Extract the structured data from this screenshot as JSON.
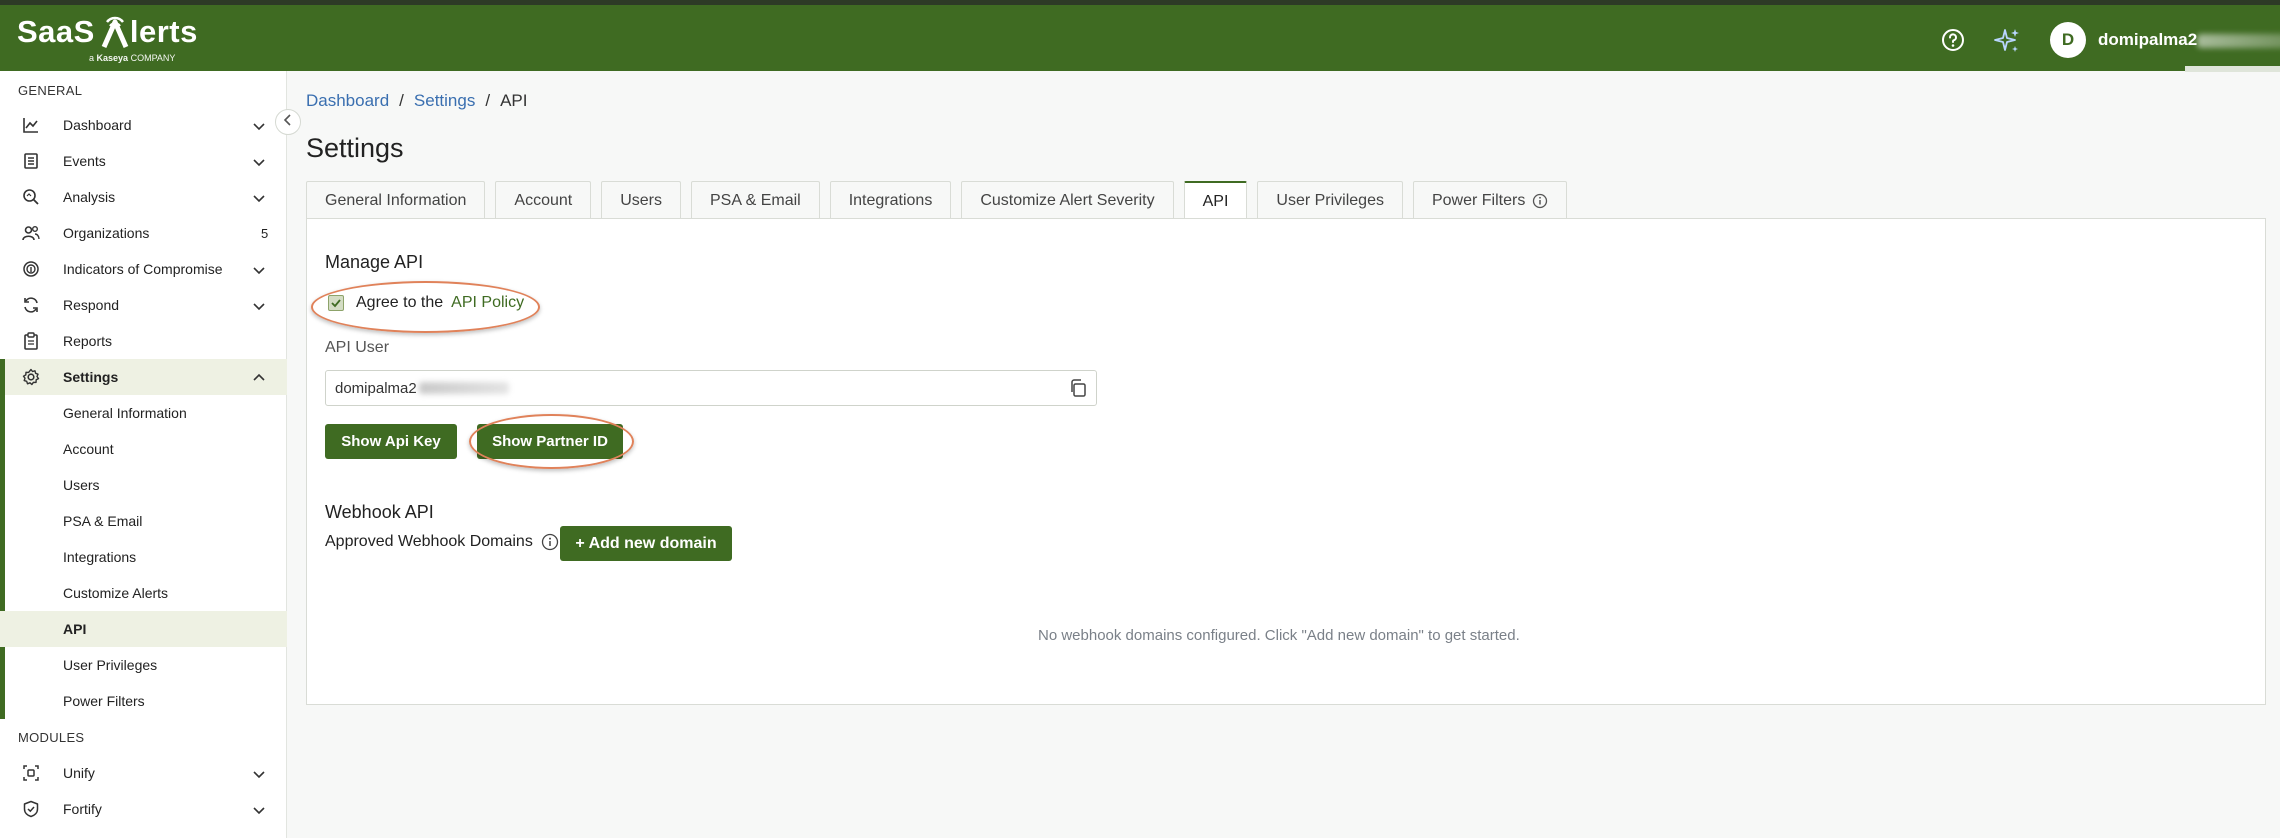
{
  "header": {
    "logo_text_1": "SaaS",
    "logo_text_2": "lerts",
    "logo_sub_prefix": "a",
    "logo_sub_brand": "Kaseya",
    "logo_sub_suffix": "COMPANY",
    "avatar_initial": "D",
    "user_name": "domipalma2"
  },
  "sidebar": {
    "general_label": "GENERAL",
    "modules_label": "MODULES",
    "items": [
      {
        "label": "Dashboard"
      },
      {
        "label": "Events"
      },
      {
        "label": "Analysis"
      },
      {
        "label": "Organizations",
        "count": "5"
      },
      {
        "label": "Indicators of Compromise"
      },
      {
        "label": "Respond"
      },
      {
        "label": "Reports"
      },
      {
        "label": "Settings"
      }
    ],
    "settings_sub": [
      {
        "label": "General Information"
      },
      {
        "label": "Account"
      },
      {
        "label": "Users"
      },
      {
        "label": "PSA & Email"
      },
      {
        "label": "Integrations"
      },
      {
        "label": "Customize Alerts"
      },
      {
        "label": "API"
      },
      {
        "label": "User Privileges"
      },
      {
        "label": "Power Filters"
      }
    ],
    "modules": [
      {
        "label": "Unify"
      },
      {
        "label": "Fortify"
      }
    ]
  },
  "breadcrumb": {
    "items": [
      "Dashboard",
      "Settings",
      "API"
    ],
    "separator": "/"
  },
  "page_title": "Settings",
  "tabs": [
    {
      "label": "General Information"
    },
    {
      "label": "Account"
    },
    {
      "label": "Users"
    },
    {
      "label": "PSA & Email"
    },
    {
      "label": "Integrations"
    },
    {
      "label": "Customize Alert Severity"
    },
    {
      "label": "API"
    },
    {
      "label": "User Privileges"
    },
    {
      "label": "Power Filters"
    }
  ],
  "manage_api": {
    "title": "Manage API",
    "agree_text": "Agree to the",
    "policy_link": "API Policy",
    "agree_checked": true,
    "api_user_label": "API User",
    "api_user_value": "domipalma2",
    "show_api_key": "Show Api Key",
    "show_partner_id": "Show Partner ID"
  },
  "webhook": {
    "title": "Webhook API",
    "approved_label": "Approved Webhook Domains",
    "add_button": "+ Add new domain",
    "empty_message": "No webhook domains configured. Click \"Add new domain\" to get started."
  },
  "colors": {
    "brand_green": "#3f6b22",
    "annotation_ring": "#e0825a",
    "link_blue": "#3a6fb0"
  }
}
